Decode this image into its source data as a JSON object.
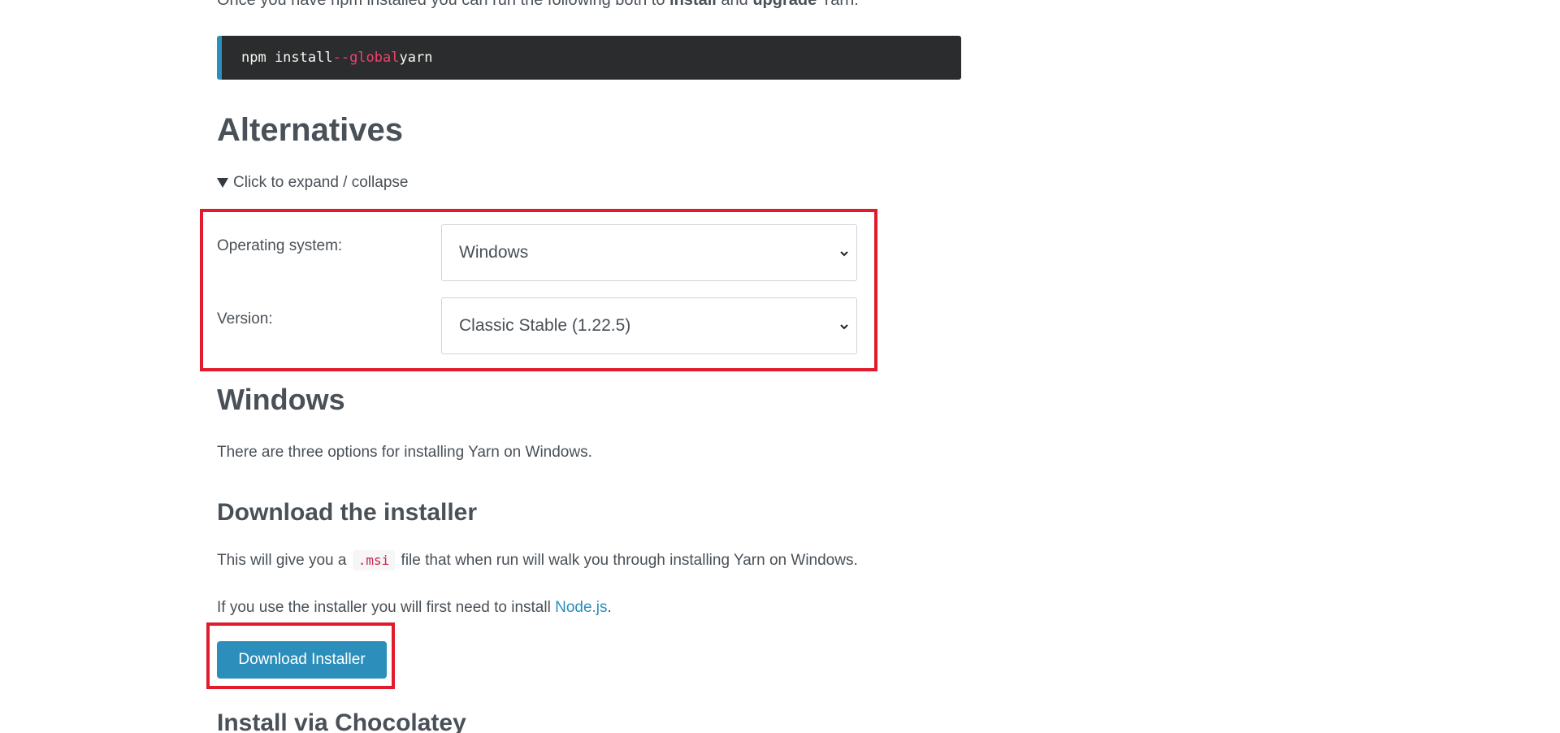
{
  "intro": {
    "text_before": "Once you have npm installed you can run the following both to",
    "install": "install",
    "and": "and",
    "upgrade": "upgrade",
    "text_after": "Yarn:"
  },
  "code": {
    "cmd": "npm install",
    "flag": "--global",
    "pkg": "yarn"
  },
  "alternatives": {
    "title": "Alternatives",
    "toggle_label": "Click to expand / collapse"
  },
  "form": {
    "os_label": "Operating system:",
    "os_value": "Windows",
    "version_label": "Version:",
    "version_value": "Classic Stable (1.22.5)"
  },
  "windows": {
    "title": "Windows",
    "lead": "There are three options for installing Yarn on Windows."
  },
  "download": {
    "title": "Download the installer",
    "msi_before": "This will give you a",
    "msi_code": ".msi",
    "msi_after": "file that when run will walk you through installing Yarn on Windows.",
    "node_before": "If you use the installer you will first need to install",
    "node_link": "Node.js",
    "node_after": ".",
    "button_label": "Download Installer"
  },
  "chocolatey": {
    "title": "Install via Chocolatey"
  },
  "colors": {
    "accent": "#2c8ebb",
    "highlight": "#e21b2c",
    "code_bg": "#2a2c2e",
    "code_flag": "#f2416d"
  }
}
